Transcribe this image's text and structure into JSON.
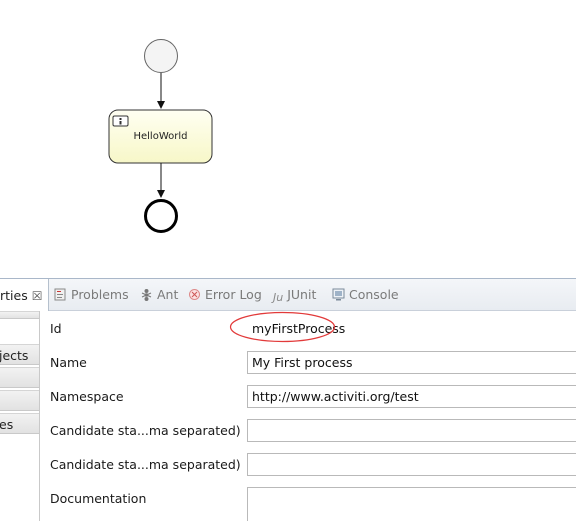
{
  "diagram": {
    "task_label": "HelloWorld"
  },
  "tabs": {
    "properties": "rties",
    "problems": "Problems",
    "ant": "Ant",
    "error_log": "Error Log",
    "junit": "JUnit",
    "console": "Console"
  },
  "sidebar": {
    "items": [
      "jects",
      "",
      "",
      "es"
    ]
  },
  "form": {
    "id_label": "Id",
    "id_value": "myFirstProcess",
    "name_label": "Name",
    "name_value": "My First process",
    "namespace_label": "Namespace",
    "namespace_value": "http://www.activiti.org/test",
    "candidate_starter_users_label": "Candidate sta...ma separated)",
    "candidate_starter_users_value": "",
    "candidate_starter_groups_label": "Candidate sta...ma separated)",
    "candidate_starter_groups_value": "",
    "documentation_label": "Documentation",
    "documentation_value": ""
  },
  "colors": {
    "task_fill": "#fdfde0",
    "highlight": "#e23a3a",
    "tab_border": "#a9b7c9"
  }
}
